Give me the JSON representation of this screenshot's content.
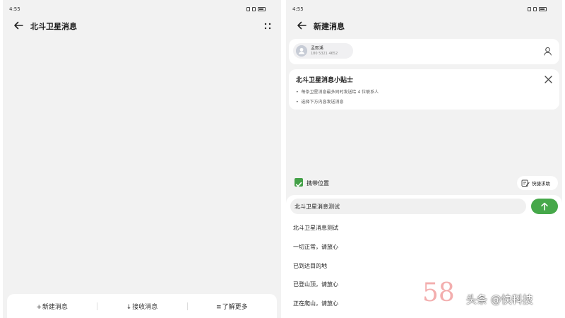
{
  "left_screen": {
    "status": {
      "time": "4:55"
    },
    "title": "北斗卫星消息",
    "bottom_bar": [
      {
        "glyph": "+",
        "label": "新建消息"
      },
      {
        "glyph": "↓",
        "label": "接收消息"
      },
      {
        "glyph": "≡",
        "label": "了解更多"
      }
    ]
  },
  "right_screen": {
    "status": {
      "time": "4:55"
    },
    "title": "新建消息",
    "recipient": {
      "name": "孟熙溪",
      "number": "180 5321 4652"
    },
    "tips": {
      "title": "北斗卫星消息小贴士",
      "items": [
        "每条卫星消息最多同时发送给 4 位联系人",
        "选择下方内容发送消息"
      ]
    },
    "location": {
      "label": "携带位置",
      "checked": true
    },
    "quick_help": {
      "label": "快捷求助"
    },
    "input": {
      "value": "北斗卫星消息测试"
    },
    "presets": [
      "北斗卫星消息测试",
      "一切正常，请放心",
      "已到达目的地",
      "已登山顶，请放心",
      "正在爬山，请放心"
    ]
  },
  "watermark": {
    "number": "58",
    "brand": "头条 @快科技"
  },
  "colors": {
    "accent_green": "#46a84a",
    "background": "#f2f2f2"
  }
}
